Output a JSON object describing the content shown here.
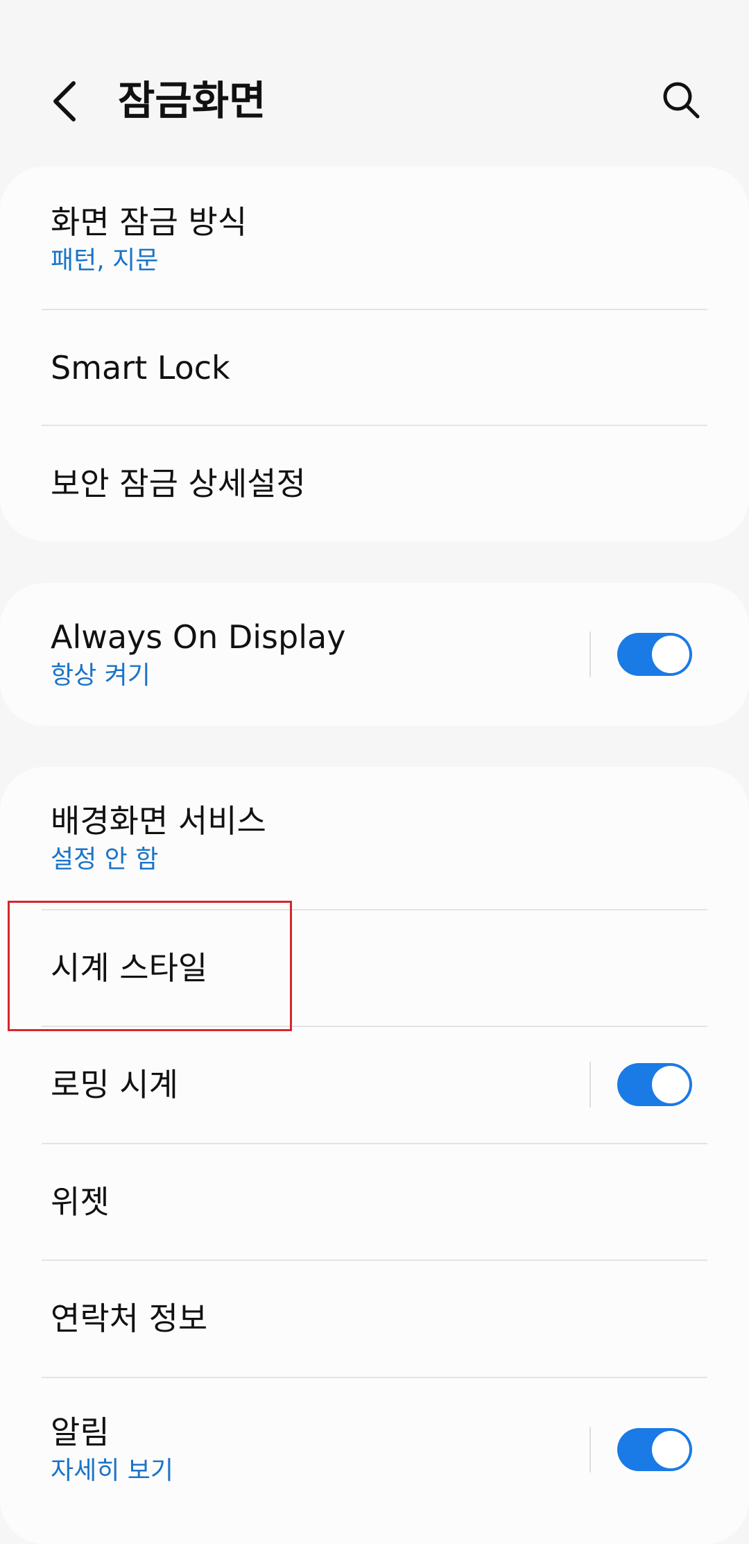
{
  "header": {
    "title": "잠금화면",
    "back_icon": "chevron-left-icon",
    "search_icon": "search-icon"
  },
  "group1": {
    "items": [
      {
        "label": "화면 잠금 방식",
        "sub": "패턴, 지문"
      },
      {
        "label": "Smart Lock"
      },
      {
        "label": "보안 잠금 상세설정"
      }
    ]
  },
  "group2": {
    "items": [
      {
        "label": "Always On Display",
        "sub": "항상 켜기",
        "toggle": true
      }
    ]
  },
  "group3": {
    "items": [
      {
        "label": "배경화면 서비스",
        "sub": "설정 안 함"
      },
      {
        "label": "시계 스타일"
      },
      {
        "label": "로밍 시계",
        "toggle": true
      },
      {
        "label": "위젯"
      },
      {
        "label": "연락처 정보"
      },
      {
        "label": "알림",
        "sub": "자세히 보기",
        "toggle": true
      }
    ]
  },
  "colors": {
    "accent": "#1a7ae6",
    "subtext": "#1a73c8",
    "highlight": "#d6262c",
    "background": "#f6f6f6"
  }
}
